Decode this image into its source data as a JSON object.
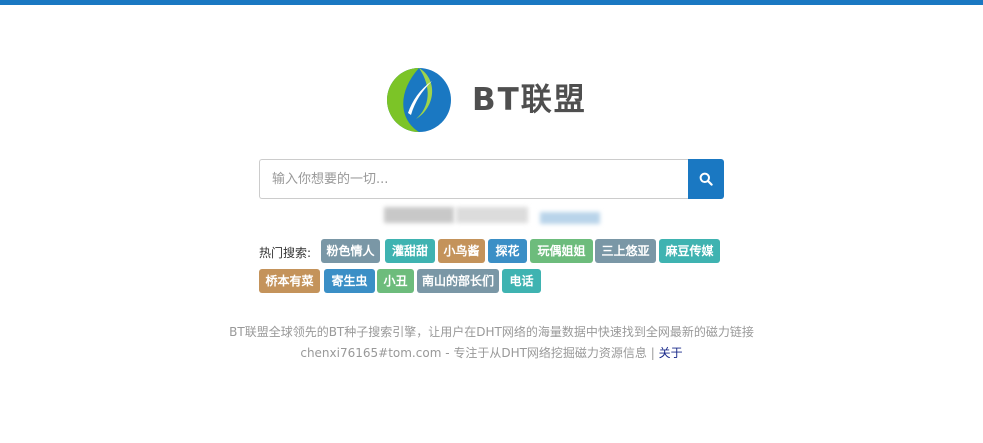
{
  "brand": {
    "name": "BT联盟",
    "colors": {
      "green": "#7cc427",
      "blue": "#1a78c2"
    }
  },
  "search": {
    "placeholder": "输入你想要的一切...",
    "button_icon": "search-icon"
  },
  "hot": {
    "label": "热门搜索:",
    "tags": [
      {
        "label": "粉色情人",
        "color": "#7a97a6"
      },
      {
        "label": "灌甜甜",
        "color": "#3fb3b1"
      },
      {
        "label": "小鸟酱",
        "color": "#c4935b"
      },
      {
        "label": "探花",
        "color": "#3b8fc6"
      },
      {
        "label": "玩偶姐姐",
        "color": "#6dbc7c"
      },
      {
        "label": "三上悠亚",
        "color": "#7a97a6"
      },
      {
        "label": "麻豆传媒",
        "color": "#3fb3b1"
      },
      {
        "label": "桥本有菜",
        "color": "#c4935b"
      },
      {
        "label": "寄生虫",
        "color": "#3b8fc6"
      },
      {
        "label": "小丑",
        "color": "#6dbc7c"
      },
      {
        "label": "南山的部长们",
        "color": "#7a97a6"
      },
      {
        "label": "电话",
        "color": "#3fb3b1"
      }
    ]
  },
  "footer": {
    "description": "BT联盟全球领先的BT种子搜索引擎，让用户在DHT网络的海量数据中快速找到全网最新的磁力链接",
    "contact": "chenxi76165#tom.com - 专注于从DHT网络挖掘磁力资源信息 |",
    "about_link": "关于"
  }
}
